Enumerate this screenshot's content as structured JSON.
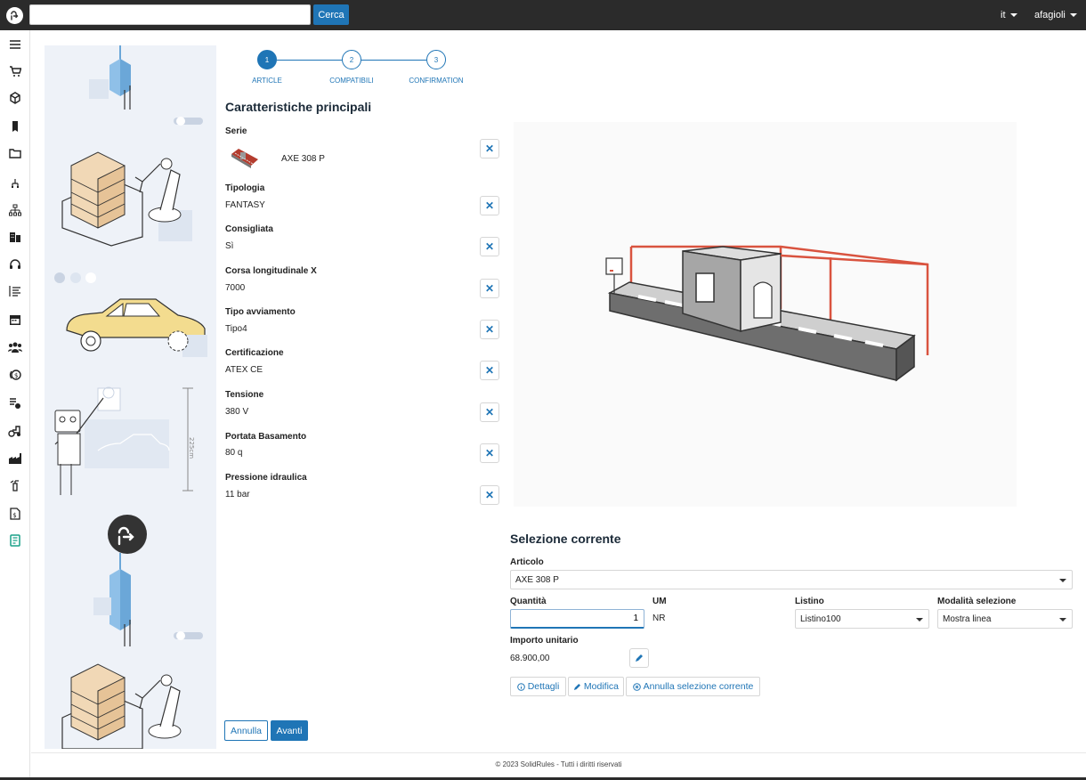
{
  "topbar": {
    "search_placeholder": "",
    "search_button": "Cerca",
    "language": "it",
    "user": "afagioli"
  },
  "sidebar": {
    "icons": [
      "menu-icon",
      "cart-icon",
      "cube-icon",
      "bookmark-icon",
      "folder-icon",
      "hierarchy-small-icon",
      "org-chart-icon",
      "building-icon",
      "headset-icon",
      "list-icon",
      "calendar-icon",
      "users-icon",
      "money-icon",
      "list-clock-icon",
      "tractor-icon",
      "factory-icon",
      "extinguisher-icon",
      "invoice-icon",
      "configurator-icon"
    ]
  },
  "stepper": {
    "steps": [
      {
        "number": "1",
        "label": "ARTICLE",
        "active": true
      },
      {
        "number": "2",
        "label": "COMPATIBILI",
        "active": false
      },
      {
        "number": "3",
        "label": "CONFIRMATION",
        "active": false
      }
    ]
  },
  "main": {
    "title": "Caratteristiche principali",
    "fields": [
      {
        "label": "Serie",
        "value": "AXE 308 P"
      },
      {
        "label": "Tipologia",
        "value": "FANTASY"
      },
      {
        "label": "Consigliata",
        "value": "Sì"
      },
      {
        "label": "Corsa longitudinale X",
        "value": "7000"
      },
      {
        "label": "Tipo avviamento",
        "value": "Tipo4"
      },
      {
        "label": "Certificazione",
        "value": "ATEX CE"
      },
      {
        "label": "Tensione",
        "value": "380 V"
      },
      {
        "label": "Portata Basamento",
        "value": "80 q"
      },
      {
        "label": "Pressione idraulica",
        "value": "11 bar"
      }
    ],
    "illustration_text": "225cm"
  },
  "selection": {
    "title": "Selezione corrente",
    "articolo_label": "Articolo",
    "articolo_value": "AXE 308 P",
    "quantita_label": "Quantità",
    "quantita_value": "1",
    "um_label": "UM",
    "um_value": "NR",
    "listino_label": "Listino",
    "listino_value": "Listino100",
    "modalita_label": "Modalità selezione",
    "modalita_value": "Mostra linea",
    "importo_label": "Importo unitario",
    "importo_value": "68.900,00",
    "btn_dettagli": "Dettagli",
    "btn_modifica": "Modifica",
    "btn_annulla_sel": "Annulla selezione corrente"
  },
  "actions": {
    "annulla": "Annulla",
    "avanti": "Avanti"
  },
  "footer": {
    "text": "© 2023 SolidRules - Tutti i diritti riservati"
  },
  "colors": {
    "primary": "#1f75b6",
    "topbar": "#2b2b2b",
    "illustration_bg": "#eef2f8",
    "rail_red": "#d9533f"
  }
}
